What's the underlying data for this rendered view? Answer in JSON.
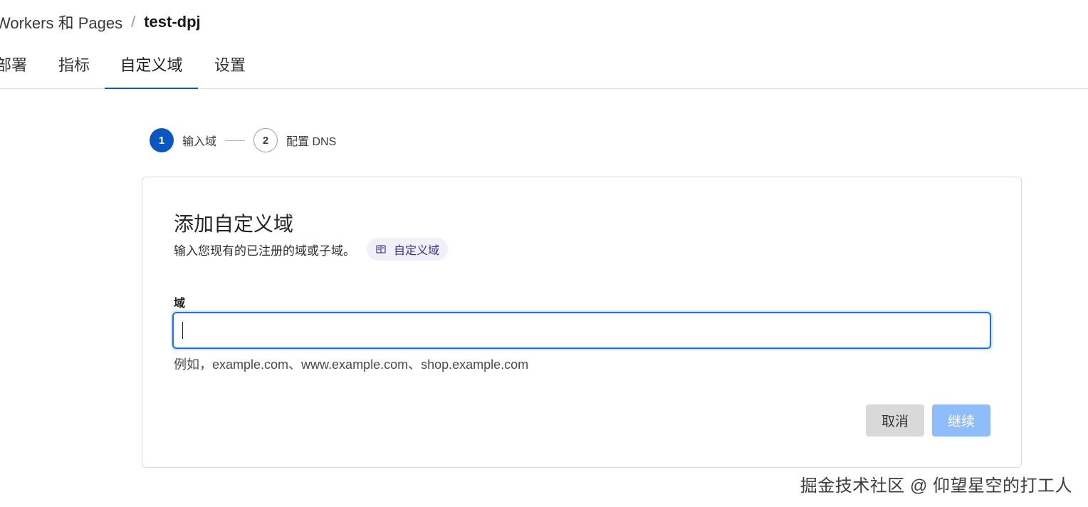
{
  "breadcrumb": {
    "parent": "Workers 和 Pages",
    "separator": "/",
    "current": "test-dpj"
  },
  "tabs": [
    {
      "label": "部署",
      "active": false
    },
    {
      "label": "指标",
      "active": false
    },
    {
      "label": "自定义域",
      "active": true
    },
    {
      "label": "设置",
      "active": false
    }
  ],
  "stepper": {
    "steps": [
      {
        "number": "1",
        "label": "输入域",
        "active": true
      },
      {
        "number": "2",
        "label": "配置 DNS",
        "active": false
      }
    ]
  },
  "card": {
    "title": "添加自定义域",
    "description": "输入您现有的已注册的域或子域。",
    "doc_badge": {
      "label": "自定义域",
      "icon": "book-icon"
    },
    "field": {
      "label": "域",
      "value": "",
      "placeholder": "",
      "hint": "例如，example.com、www.example.com、shop.example.com"
    },
    "buttons": {
      "cancel": "取消",
      "continue": "继续"
    }
  },
  "watermark": "掘金技术社区 @ 仰望星空的打工人",
  "colors": {
    "primary": "#0a57c2",
    "focus_border": "#1a73e8",
    "continue_disabled": "#8fbcfa",
    "cancel_bg": "#d9d9d9",
    "badge_bg": "#f1eff8",
    "badge_text": "#3b2f8f"
  }
}
